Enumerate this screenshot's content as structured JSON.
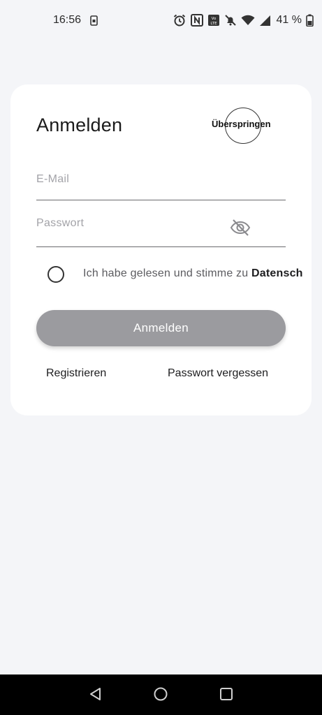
{
  "status_bar": {
    "time": "16:56",
    "battery_text": "41 %",
    "icons": [
      "sim-icon",
      "alarm-icon",
      "nfc-icon",
      "volte-icon",
      "mute-icon",
      "wifi-icon",
      "signal-icon",
      "battery-icon"
    ]
  },
  "login": {
    "title": "Anmelden",
    "skip_label": "Überspringen",
    "email_placeholder": "E-Mail",
    "password_placeholder": "Passwort",
    "consent_text": "Ich habe gelesen und stimme zu ",
    "consent_link": "Datensch",
    "submit_label": "Anmelden",
    "register_label": "Registrieren",
    "forgot_label": "Passwort vergessen",
    "submit_enabled": false
  },
  "nav_bar": {
    "buttons": [
      "back-icon",
      "home-icon",
      "recents-icon"
    ]
  },
  "colors": {
    "background": "#f4f5f8",
    "card": "#ffffff",
    "button_disabled": "#9b9b9f",
    "text": "#1d1d1f",
    "placeholder": "#a3a3a8"
  }
}
